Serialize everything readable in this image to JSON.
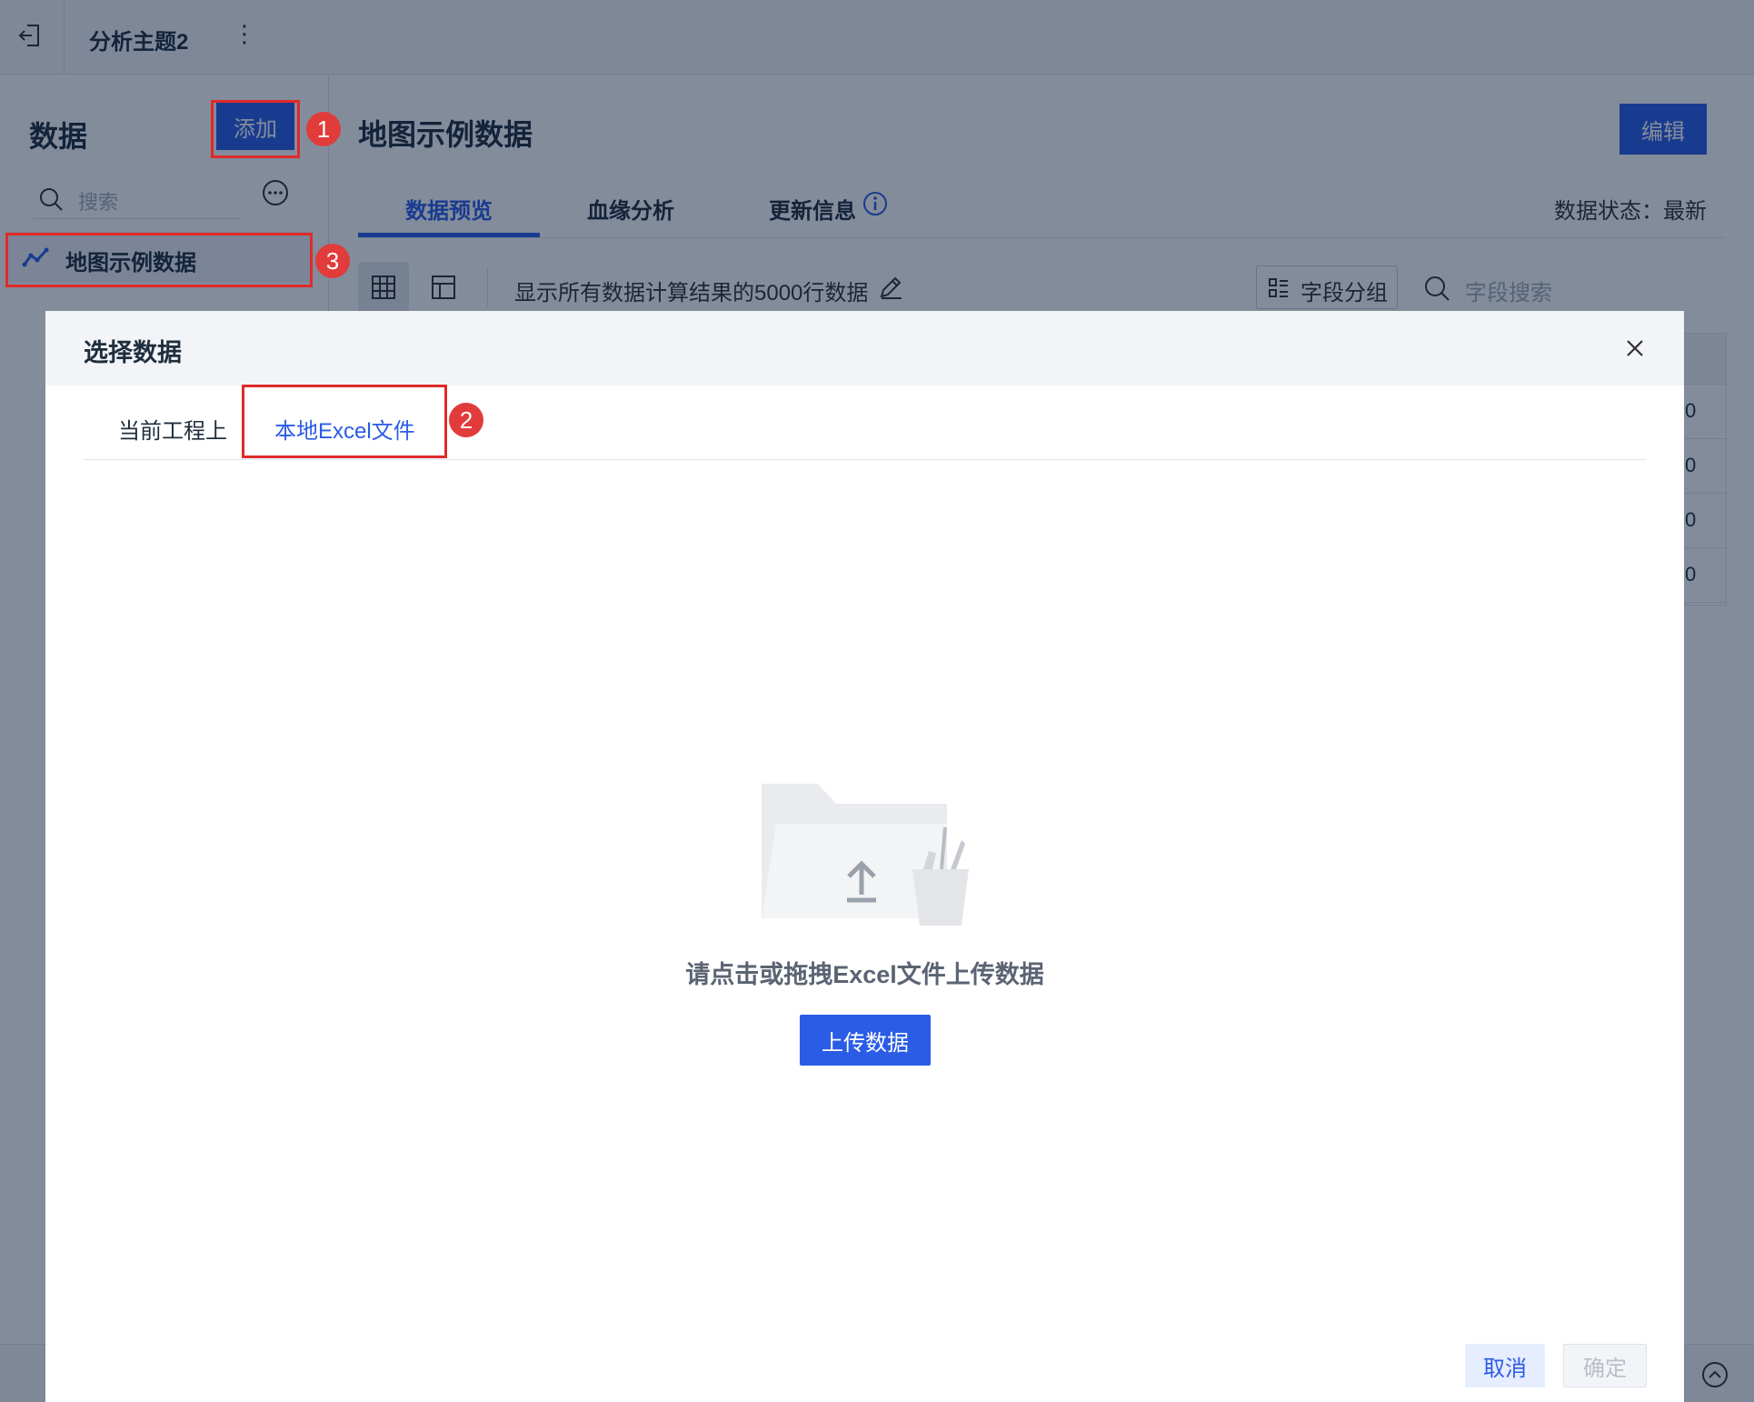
{
  "topbar": {
    "title": "分析主题2",
    "more_icon": "more-vertical-icon",
    "exit_icon": "exit-icon"
  },
  "sidebar": {
    "title": "数据",
    "add_label": "添加",
    "search_placeholder": "搜索",
    "dataset_item": "地图示例数据"
  },
  "main": {
    "title": "地图示例数据",
    "edit_label": "编辑",
    "tabs": [
      {
        "label": "数据预览",
        "active": true
      },
      {
        "label": "血缘分析",
        "active": false
      },
      {
        "label": "更新信息",
        "active": false
      }
    ],
    "status": "数据状态：最新",
    "toolbar_text": "显示所有数据计算结果的5000行数据",
    "field_group_label": "字段分组",
    "field_search_placeholder": "字段搜索",
    "table_edge_cells": [
      "0",
      "0",
      "0",
      "0"
    ]
  },
  "annotations": [
    "1",
    "2",
    "3"
  ],
  "dialog": {
    "title": "选择数据",
    "tabs": [
      {
        "label": "当前工程上",
        "active": false
      },
      {
        "label": "本地Excel文件",
        "active": true
      }
    ],
    "empty_message": "请点击或拖拽Excel文件上传数据",
    "upload_label": "上传数据",
    "cancel_label": "取消",
    "confirm_label": "确定"
  },
  "colors": {
    "primary": "#2b5ce6",
    "highlight_red": "#e02a2a",
    "badge_red": "#e23b3b"
  }
}
